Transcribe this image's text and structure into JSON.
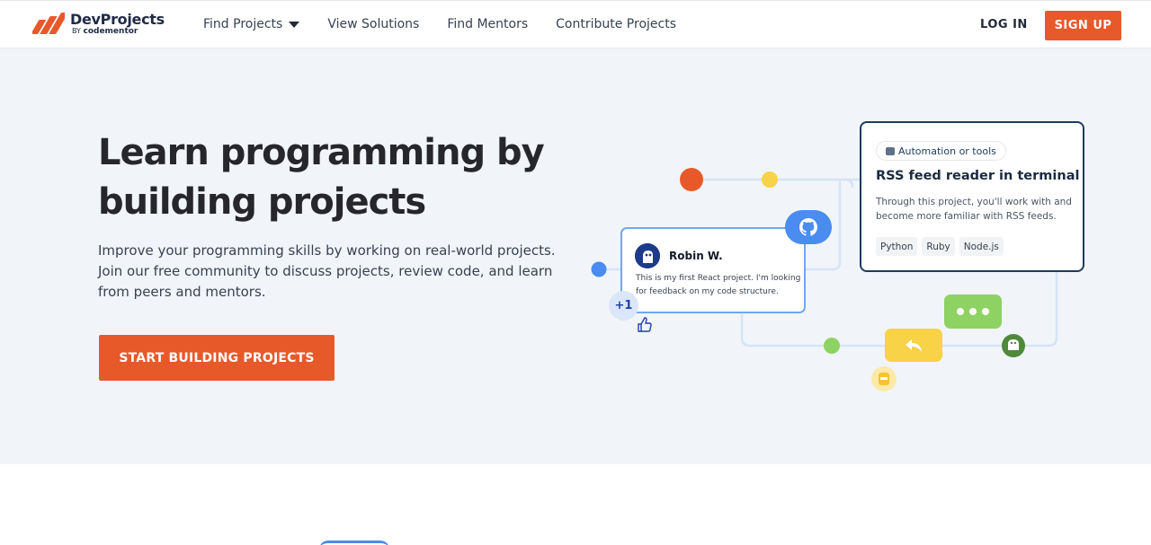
{
  "brand": {
    "name": "DevProjects",
    "by": "BY",
    "parent": "codementor"
  },
  "nav": {
    "items": [
      {
        "label": "Find Projects",
        "has_dropdown": true
      },
      {
        "label": "View Solutions"
      },
      {
        "label": "Find Mentors"
      },
      {
        "label": "Contribute Projects"
      }
    ],
    "login_label": "LOG IN",
    "signup_label": "SIGN UP"
  },
  "hero": {
    "title": "Learn programming by building projects",
    "subtitle": "Improve your programming skills by working on real-world projects. Join our free community to discuss projects, review code, and learn from peers and mentors.",
    "cta_label": "START BUILDING PROJECTS"
  },
  "illustration": {
    "project_card": {
      "tag": "Automation or tools",
      "title": "RSS feed reader in terminal",
      "description": "Through this project, you'll work with and become more familiar with RSS feeds.",
      "chips": [
        "Python",
        "Ruby",
        "Node.js"
      ]
    },
    "comment_card": {
      "author": "Robin W.",
      "text": "This is my first React project. I'm looking for feedback on my code structure."
    },
    "reaction_count": "+1"
  },
  "colors": {
    "accent": "#e8592a",
    "hero_bg": "#f1f5fa",
    "navy": "#1e3a5f",
    "blue": "#4a8cf0",
    "green": "#8ed263",
    "yellow": "#f8d247"
  }
}
